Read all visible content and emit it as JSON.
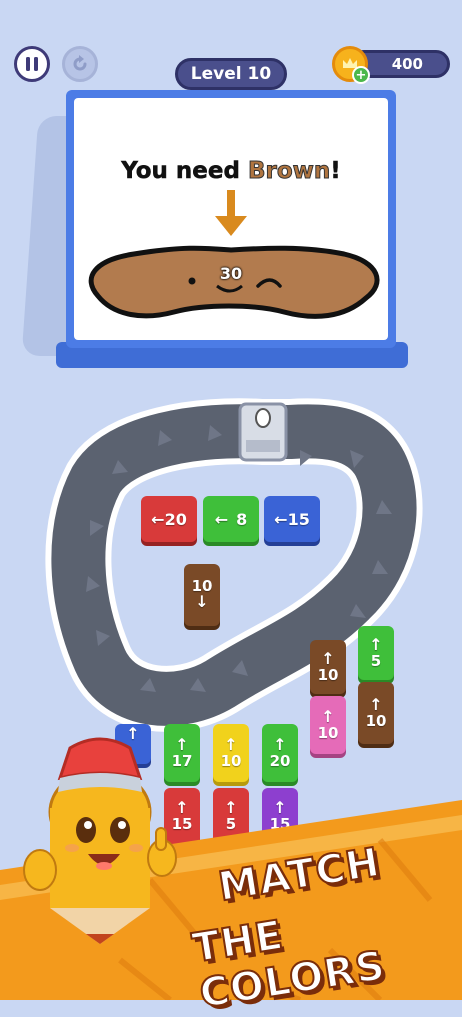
{
  "header": {
    "level_label": "Level 10",
    "coin_count": "400",
    "plus_label": "+"
  },
  "board": {
    "need_prefix": "You need",
    "need_color": "Brown",
    "need_suffix": "!",
    "target_count": "30",
    "target_color": "#b27b4e"
  },
  "blocks": {
    "red_left": {
      "arrow": "←",
      "value": "20",
      "color": "#d83a3a"
    },
    "green_left": {
      "arrow": "←",
      "value": "8",
      "color": "#3fbf3a"
    },
    "blue_left": {
      "arrow": "←",
      "value": "15",
      "color": "#3a63d6"
    },
    "brown_down": {
      "arrow": "↓",
      "value": "10",
      "color": "#7a4a27"
    },
    "brown_up_a": {
      "arrow": "↑",
      "value": "10",
      "color": "#7a4a27"
    },
    "green_up_a": {
      "arrow": "↑",
      "value": "5",
      "color": "#3fbf3a"
    },
    "pink_up": {
      "arrow": "↑",
      "value": "10",
      "color": "#e56bb8"
    },
    "brown_up_b": {
      "arrow": "↑",
      "value": "10",
      "color": "#7a4a27"
    },
    "blue_up_partial": {
      "arrow": "↑",
      "color": "#3a63d6"
    },
    "green_up_b": {
      "arrow": "↑",
      "value": "17",
      "color": "#3fbf3a"
    },
    "yellow_up": {
      "arrow": "↑",
      "value": "10",
      "color": "#f1d21c"
    },
    "green_up_c": {
      "arrow": "↑",
      "value": "20",
      "color": "#3fbf3a"
    },
    "red_up_a": {
      "arrow": "↑",
      "value": "15",
      "color": "#d83a3a"
    },
    "red_up_b": {
      "arrow": "↑",
      "value": "5",
      "color": "#d83a3a"
    },
    "purple_up": {
      "arrow": "↑",
      "value": "15",
      "color": "#8d3fcf"
    }
  },
  "banner": {
    "line1": "MATCH",
    "line2": "THE COLORS"
  },
  "icons": [
    "pause-icon",
    "restart-icon",
    "crown-coin-icon",
    "down-arrow-icon",
    "pencil-mascot"
  ]
}
